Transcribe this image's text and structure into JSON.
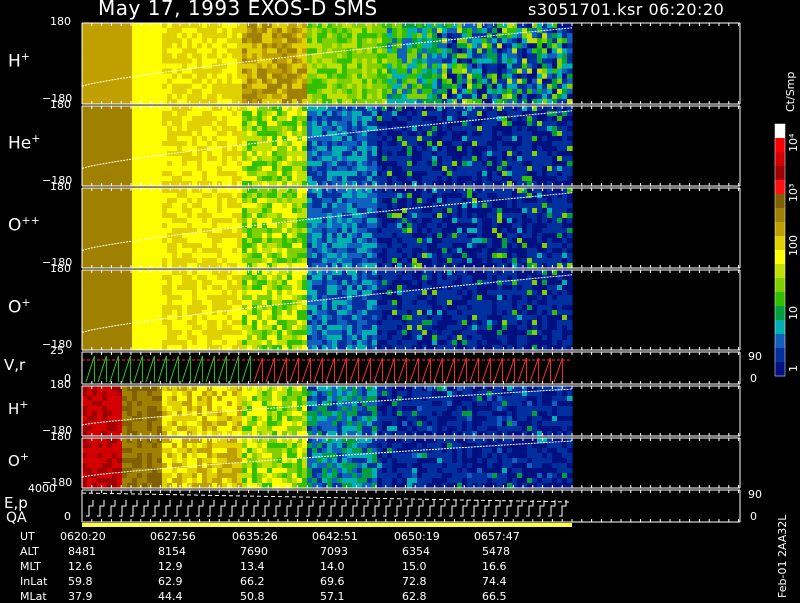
{
  "header": {
    "title": "May 17, 1993   EXOS-D SMS",
    "file_time": "s3051701.ksr  06:20:20"
  },
  "panels": [
    {
      "label": "H",
      "sup": "+",
      "ytop": "180",
      "ybot": "−180"
    },
    {
      "label": "He",
      "sup": "+",
      "ytop": "180",
      "ybot": "−180"
    },
    {
      "label": "O",
      "sup": "++",
      "ytop": "180",
      "ybot": "−180"
    },
    {
      "label": "O",
      "sup": "+",
      "ytop": "180",
      "ybot": "−180"
    },
    {
      "label": "V,r",
      "sup": "",
      "ytop": "25",
      "ybot": "0",
      "rtop": "90",
      "rbot": "0"
    },
    {
      "label": "H",
      "sup": "+",
      "ytop": "180",
      "ybot": "−180"
    },
    {
      "label": "O",
      "sup": "+",
      "ytop": "180",
      "ybot": "−180"
    },
    {
      "label": "E,p",
      "sup": "",
      "ytop": "4000",
      "ybot": "0",
      "rtop": "90",
      "rbot": "0"
    }
  ],
  "qa_label": "QA",
  "colorbar": {
    "unit": "Ct/Smp",
    "labels": [
      "10⁴",
      "10³",
      "100",
      "10",
      "1"
    ],
    "colors": [
      "#ffffff",
      "#ff0000",
      "#d40000",
      "#a00000",
      "#ff1010",
      "#806000",
      "#a08000",
      "#c0a000",
      "#e0d000",
      "#ffff00",
      "#c0e000",
      "#80d000",
      "#30c000",
      "#00a040",
      "#00b0b0",
      "#1060c0",
      "#0030a0",
      "#001080"
    ]
  },
  "footer": {
    "rows": [
      {
        "name": "UT",
        "values": [
          "0620:20",
          "0627:56",
          "0635:26",
          "0642:51",
          "0650:19",
          "0657:47"
        ]
      },
      {
        "name": "ALT",
        "values": [
          "8481",
          "8154",
          "7690",
          "7093",
          "6354",
          "5478"
        ]
      },
      {
        "name": "MLT",
        "values": [
          "12.6",
          "12.9",
          "13.4",
          "14.0",
          "15.0",
          "16.6"
        ]
      },
      {
        "name": "InLat",
        "values": [
          "59.8",
          "62.9",
          "66.2",
          "69.6",
          "72.8",
          "74.4"
        ]
      },
      {
        "name": "MLat",
        "values": [
          "37.9",
          "44.4",
          "50.8",
          "57.1",
          "62.8",
          "66.5"
        ]
      }
    ],
    "side_note": "Feb-01 2AA32L"
  },
  "chart_data": {
    "type": "heatmap",
    "title": "May 17, 1993   EXOS-D SMS",
    "x_ticks": [
      "0620:20",
      "0627:56",
      "0635:26",
      "0642:51",
      "0650:19",
      "0657:47"
    ],
    "panels": [
      "H+",
      "He+",
      "O++",
      "O+",
      "V,r",
      "H+",
      "O+",
      "E,p"
    ],
    "spectrogram_ylim": [
      -180,
      180
    ],
    "vr_ylim": [
      0,
      25
    ],
    "ep_ylim": [
      0,
      4000
    ],
    "colorbar_unit": "Ct/Smp",
    "colorbar_ticks": [
      "1",
      "10",
      "100",
      "10³",
      "10⁴"
    ]
  }
}
